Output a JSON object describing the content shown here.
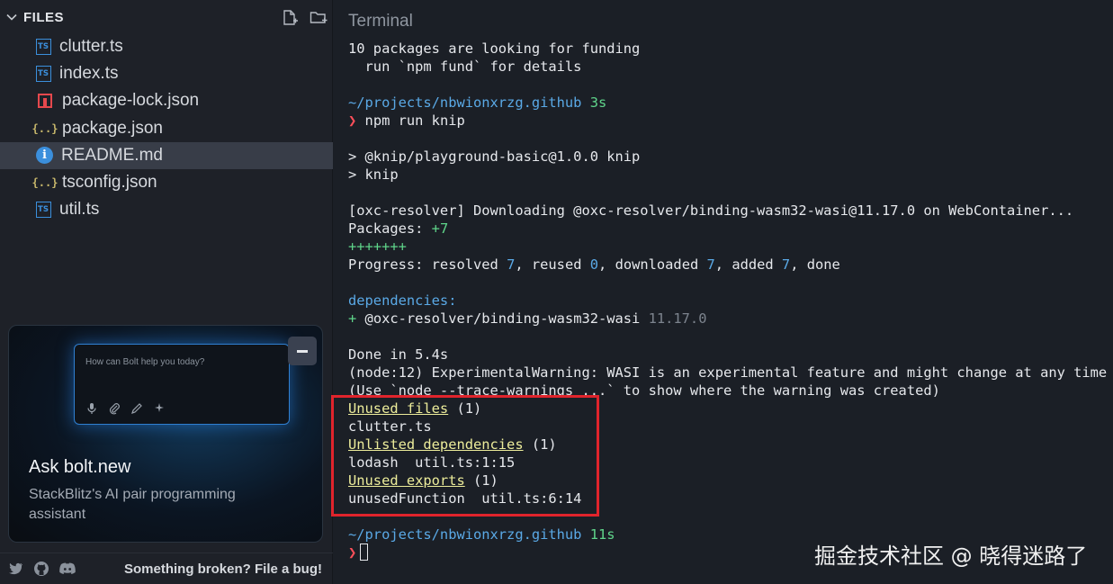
{
  "sidebar": {
    "header": {
      "title": "FILES"
    },
    "files": [
      {
        "name": "clutter.ts",
        "icon": "typescript-file-icon",
        "selected": false
      },
      {
        "name": "index.ts",
        "icon": "typescript-file-icon",
        "selected": false
      },
      {
        "name": "package-lock.json",
        "icon": "npm-lock-file-icon",
        "selected": false
      },
      {
        "name": "package.json",
        "icon": "json-file-icon",
        "selected": false
      },
      {
        "name": "README.md",
        "icon": "info-file-icon",
        "selected": true
      },
      {
        "name": "tsconfig.json",
        "icon": "json-file-icon",
        "selected": false
      },
      {
        "name": "util.ts",
        "icon": "typescript-file-icon",
        "selected": false
      }
    ],
    "promo": {
      "placeholder": "How can Bolt help you today?",
      "title": "Ask bolt.new",
      "subtitle": "StackBlitz's AI pair programming assistant"
    },
    "footer": {
      "bug_link": "Something broken? File a bug!"
    }
  },
  "terminal": {
    "title": "Terminal",
    "lines": {
      "l1": "10 packages are looking for funding",
      "l2": "  run `npm fund` for details",
      "l4_path": "~/projects/nbwionxrzg.github",
      "l4_time": "3s",
      "l5_prompt": "❯",
      "l5_cmd": " npm run knip",
      "l7": "> @knip/playground-basic@1.0.0 knip",
      "l8": "> knip",
      "l10": "[oxc-resolver] Downloading @oxc-resolver/binding-wasm32-wasi@11.17.0 on WebContainer...",
      "l11_label": "Packages: ",
      "l11_val": "+7",
      "l12": "+++++++",
      "l13_a": "Progress: resolved ",
      "l13_b": "7",
      "l13_c": ", reused ",
      "l13_d": "0",
      "l13_e": ", downloaded ",
      "l13_f": "7",
      "l13_g": ", added ",
      "l13_h": "7",
      "l13_i": ", done",
      "l15": "dependencies:",
      "l16_plus": "+ ",
      "l16_pkg": "@oxc-resolver/binding-wasm32-wasi",
      "l16_ver": " 11.17.0",
      "l18": "Done in 5.4s",
      "l19": "(node:12) ExperimentalWarning: WASI is an experimental feature and might change at any time",
      "l20": "(Use `node --trace-warnings ...` to show where the warning was created)",
      "l21_h": "Unused files",
      "l21_c": " (1)",
      "l22": "clutter.ts",
      "l23_h": "Unlisted dependencies",
      "l23_c": " (1)",
      "l24": "lodash  util.ts:1:15",
      "l25_h": "Unused exports",
      "l25_c": " (1)",
      "l26": "unusedFunction  util.ts:6:14",
      "l28_path": "~/projects/nbwionxrzg.github",
      "l28_time": "11s",
      "l29_prompt": "❯"
    }
  },
  "watermark": "掘金技术社区 @ 晓得迷路了",
  "colors": {
    "accent_blue": "#5aa9e6",
    "success_green": "#5fd48a",
    "prompt_red": "#ff4f5a",
    "heading_yellow": "#ecec9a",
    "highlight_red": "#e0242c"
  }
}
